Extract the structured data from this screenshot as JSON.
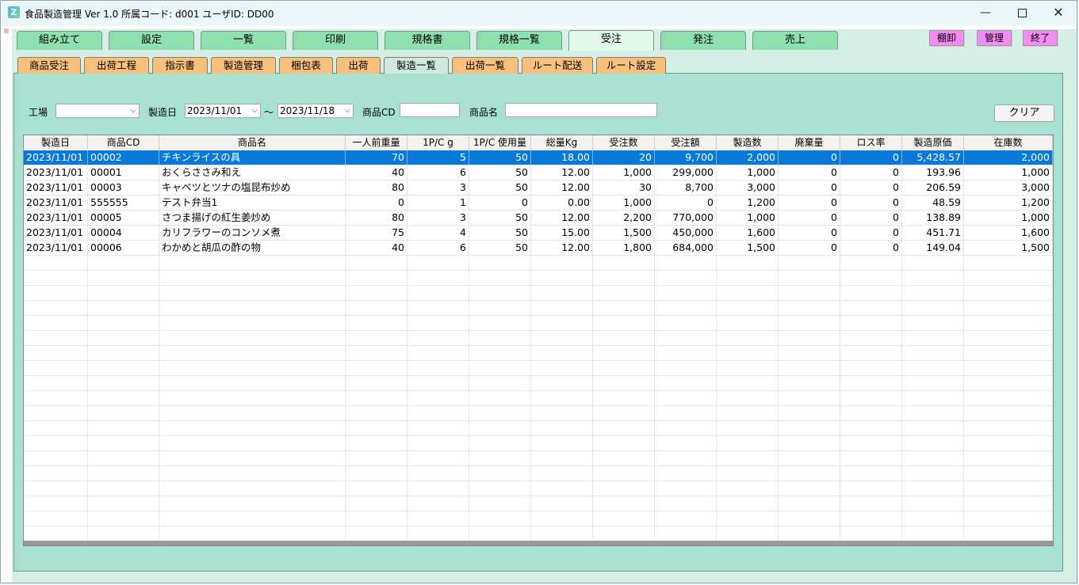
{
  "window": {
    "icon_glyph": "Z",
    "title": "食品製造管理 Ver 1.0  所属コード: d001    ユーザID: DD00",
    "minimize": "—",
    "close": "✕"
  },
  "top_tabs": [
    "組み立て",
    "設定",
    "一覧",
    "印刷",
    "規格書",
    "規格一覧",
    "受注",
    "発注",
    "売上"
  ],
  "top_active": "受注",
  "top_actions": [
    "棚卸",
    "管理",
    "終了"
  ],
  "sub_tabs": [
    "商品受注",
    "出荷工程",
    "指示書",
    "製造管理",
    "梱包表",
    "出荷",
    "製造一覧",
    "出荷一覧",
    "ルート配送",
    "ルート設定"
  ],
  "sub_active": "製造一覧",
  "filters": {
    "factory_label": "工場",
    "factory_value": "",
    "date_label": "製造日",
    "date_from": "2023/11/01",
    "date_sep": "～",
    "date_to": "2023/11/18",
    "code_label": "商品CD",
    "code_value": "",
    "name_label": "商品名",
    "name_value": "",
    "clear_button": "クリア"
  },
  "table": {
    "columns": [
      "製造日",
      "商品CD",
      "商品名",
      "一人前重量",
      "1P/C g",
      "1P/C 使用量",
      "総量Kg",
      "受注数",
      "受注額",
      "製造数",
      "廃棄量",
      "ロス率",
      "製造原価",
      "在庫数"
    ],
    "rows": [
      [
        "2023/11/01",
        "00002",
        "チキンライスの具",
        "70",
        "5",
        "50",
        "18.00",
        "20",
        "9,700",
        "2,000",
        "0",
        "0",
        "5,428.57",
        "2,000"
      ],
      [
        "2023/11/01",
        "00001",
        "おくらささみ和え",
        "40",
        "6",
        "50",
        "12.00",
        "1,000",
        "299,000",
        "1,000",
        "0",
        "0",
        "193.96",
        "1,000"
      ],
      [
        "2023/11/01",
        "00003",
        "キャベツとツナの塩昆布炒め",
        "80",
        "3",
        "50",
        "12.00",
        "30",
        "8,700",
        "3,000",
        "0",
        "0",
        "206.59",
        "3,000"
      ],
      [
        "2023/11/01",
        "555555",
        "テスト弁当1",
        "0",
        "1",
        "0",
        "0.00",
        "1,000",
        "0",
        "1,200",
        "0",
        "0",
        "48.59",
        "1,200"
      ],
      [
        "2023/11/01",
        "00005",
        "さつま揚げの紅生姜炒め",
        "80",
        "3",
        "50",
        "12.00",
        "2,200",
        "770,000",
        "1,000",
        "0",
        "0",
        "138.89",
        "1,000"
      ],
      [
        "2023/11/01",
        "00004",
        "カリフラワーのコンソメ煮",
        "75",
        "4",
        "50",
        "15.00",
        "1,500",
        "450,000",
        "1,600",
        "0",
        "0",
        "451.71",
        "1,600"
      ],
      [
        "2023/11/01",
        "00006",
        "わかめと胡瓜の酢の物",
        "40",
        "6",
        "50",
        "12.00",
        "1,800",
        "684,000",
        "1,500",
        "0",
        "0",
        "149.04",
        "1,500"
      ]
    ],
    "selected_row": 0
  },
  "colors": {
    "top_tab": "#8ee0ae",
    "sub_tab": "#f7c07c",
    "panel": "#a8e0d2",
    "selected": "#0a78d7",
    "pink_button": "#f48cf4"
  }
}
